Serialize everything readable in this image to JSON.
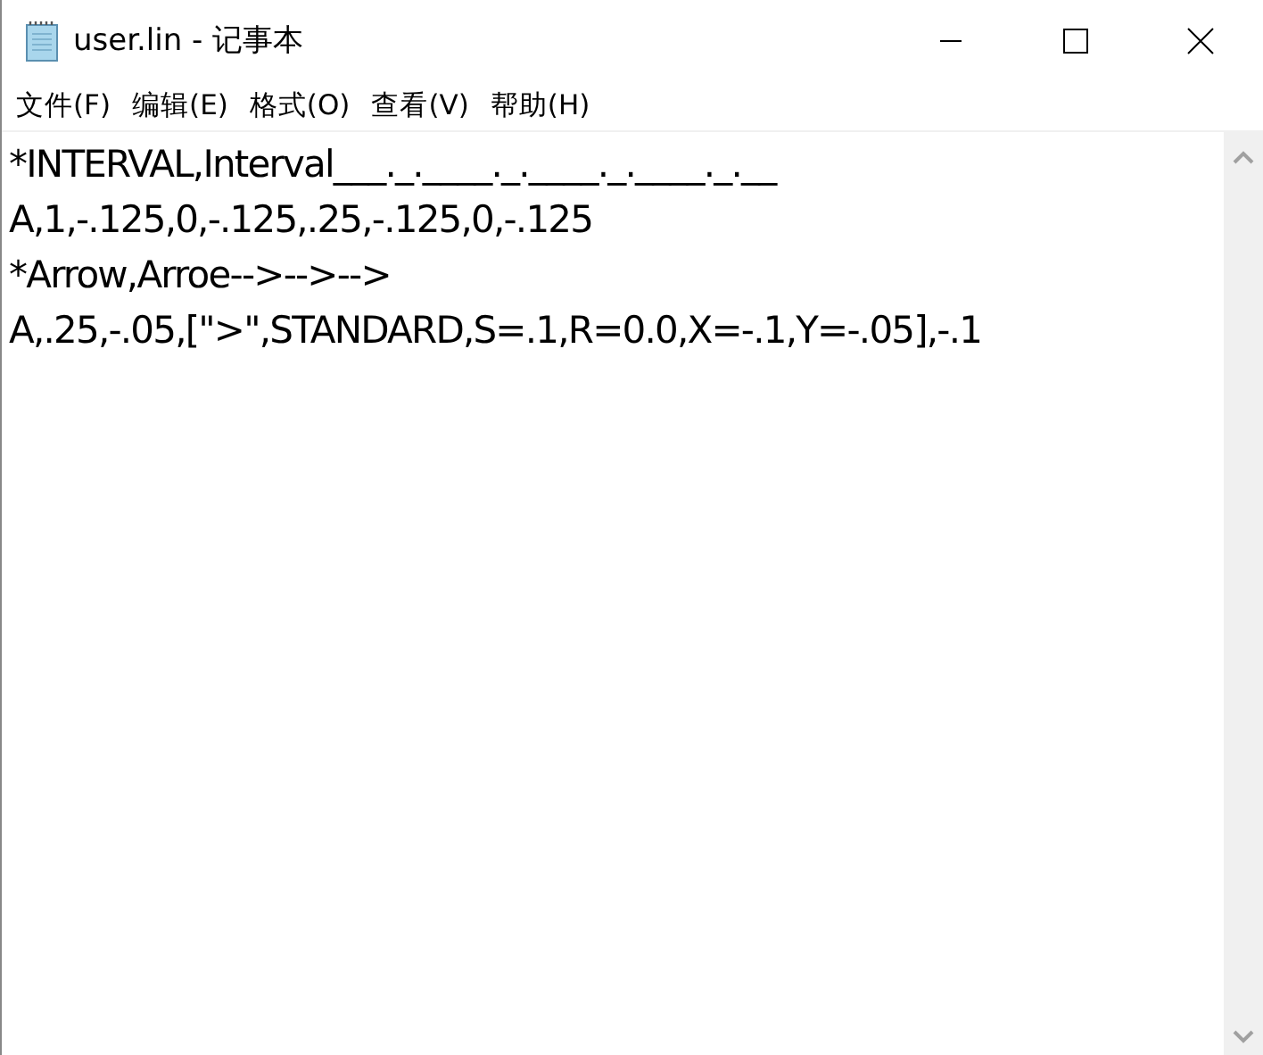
{
  "window": {
    "title": "user.lin - 记事本"
  },
  "menu": [
    "文件(F)",
    "编辑(E)",
    "格式(O)",
    "查看(V)",
    "帮助(H)"
  ],
  "editor": {
    "lines": [
      "*INTERVAL,Interval___._.____._.____._.____._.__",
      "A,1,-.125,0,-.125,.25,-.125,0,-.125",
      "*Arrow,Arroe-->-->-->",
      "A,.25,-.05,[\">\",STANDARD,S=.1,R=0.0,X=-.1,Y=-.05],-.1"
    ]
  }
}
